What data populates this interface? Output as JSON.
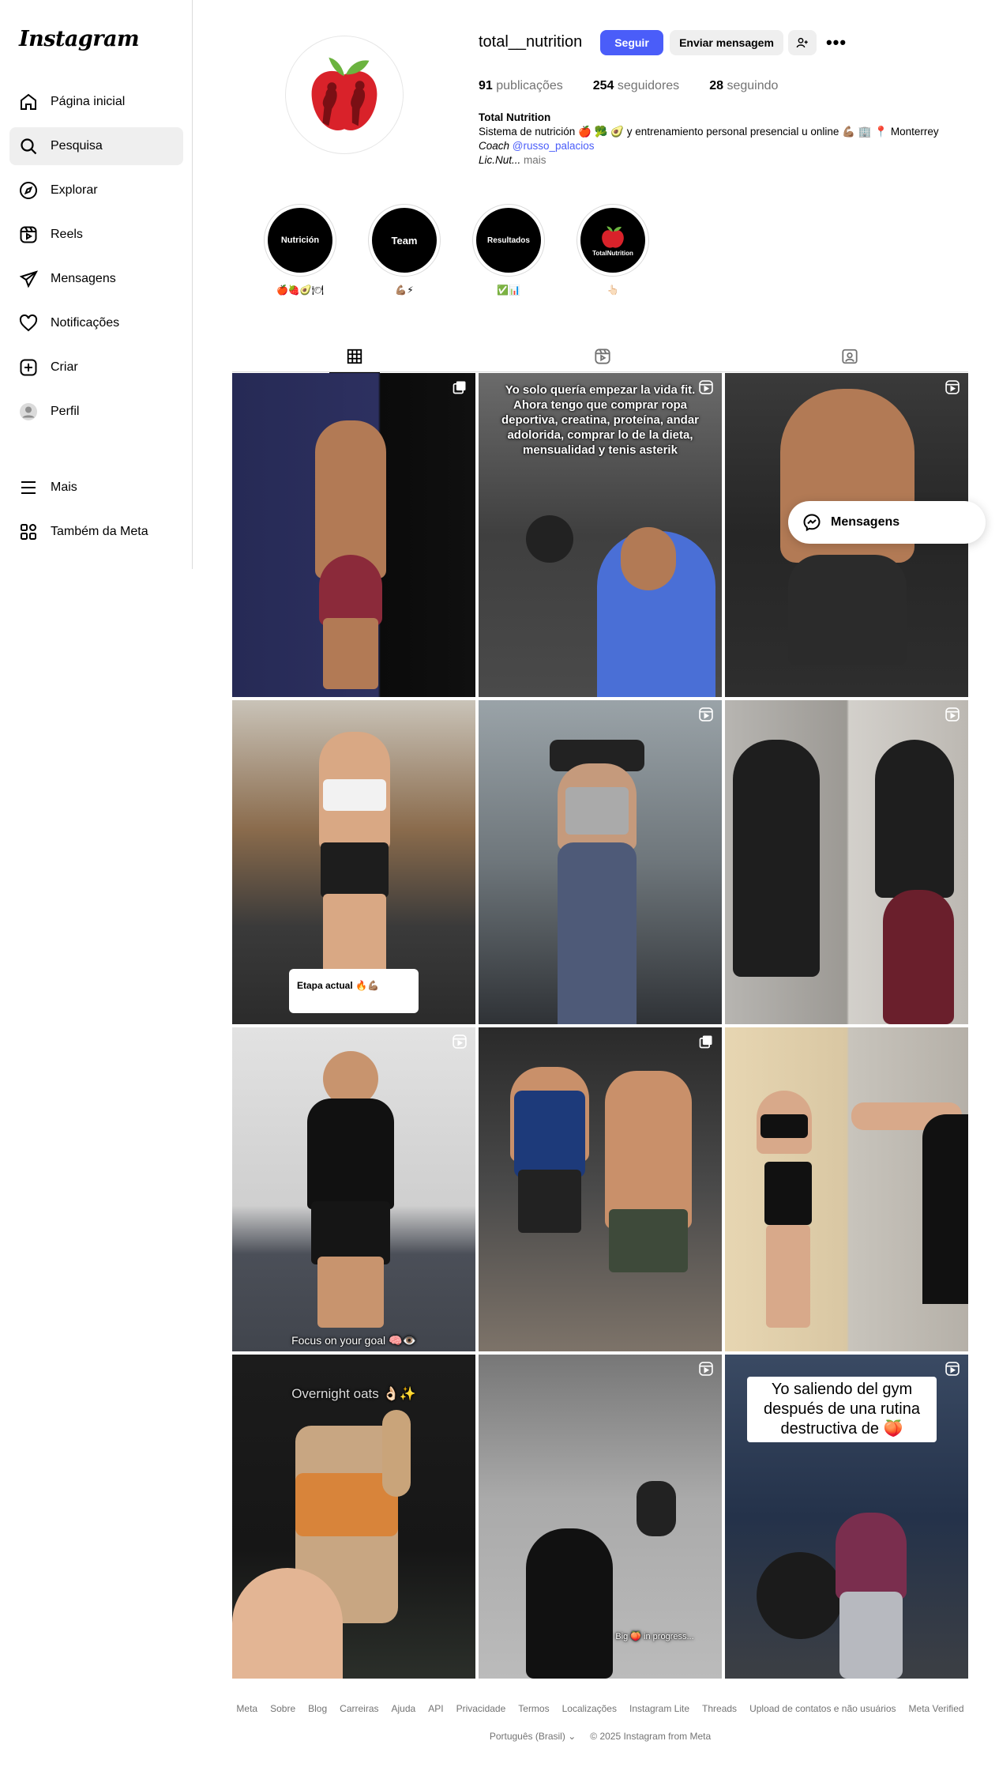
{
  "app": {
    "logo": "Instagram"
  },
  "sidebar": {
    "items": [
      {
        "label": "Página inicial",
        "icon": "home-icon"
      },
      {
        "label": "Pesquisa",
        "icon": "search-icon",
        "active": true
      },
      {
        "label": "Explorar",
        "icon": "compass-icon"
      },
      {
        "label": "Reels",
        "icon": "reels-icon"
      },
      {
        "label": "Mensagens",
        "icon": "send-icon"
      },
      {
        "label": "Notificações",
        "icon": "heart-icon"
      },
      {
        "label": "Criar",
        "icon": "plus-square-icon"
      },
      {
        "label": "Perfil",
        "icon": "avatar-icon"
      },
      {
        "label": "Mais",
        "icon": "menu-icon"
      },
      {
        "label": "Também da Meta",
        "icon": "meta-apps-icon"
      }
    ]
  },
  "profile": {
    "username": "total__nutrition",
    "follow_label": "Seguir",
    "message_label": "Enviar mensagem",
    "stats": {
      "posts_value": "91",
      "posts_label": "publicações",
      "followers_value": "254",
      "followers_label": "seguidores",
      "following_value": "28",
      "following_label": "seguindo"
    },
    "bio": {
      "name": "Total Nutrition",
      "line1": "Sistema de nutrición 🍎 🥦 🥑 y entrenamiento personal presencial u online 💪🏽 🏢 📍 Monterrey",
      "coach_prefix": "Coach",
      "coach_link": "@russo_palacios",
      "line3": "Lic.Nut...",
      "more": "mais"
    },
    "brand_color": "#4a5df9"
  },
  "highlights": [
    {
      "cover_text": "Nutrición",
      "label": "🍎🍓🥑🍽"
    },
    {
      "cover_text": "Team",
      "label": "💪🏽⚡"
    },
    {
      "cover_text": "Resultados",
      "label": "✅📊"
    },
    {
      "cover_text": "TotalNutrition",
      "label": "👆🏻"
    }
  ],
  "posts": [
    {
      "caption": ""
    },
    {
      "caption": "Yo solo quería empezar la vida fit. Ahora tengo que comprar ropa deportiva, creatina, proteína, andar adolorida, comprar lo de la dieta, mensualidad y tenis asterik"
    },
    {
      "caption": ""
    },
    {
      "caption": "Etapa actual 🔥💪🏽"
    },
    {
      "caption": ""
    },
    {
      "caption": ""
    },
    {
      "caption": "Focus on your goal 🧠👁️"
    },
    {
      "caption": ""
    },
    {
      "caption": ""
    },
    {
      "caption": "Overnight oats 👌🏻✨"
    },
    {
      "caption": "Big 🍑 in progress..."
    },
    {
      "caption": "Yo saliendo del gym después de una rutina destructiva de 🍑"
    }
  ],
  "messages_pill": {
    "label": "Mensagens"
  },
  "footer": {
    "links": [
      "Meta",
      "Sobre",
      "Blog",
      "Carreiras",
      "Ajuda",
      "API",
      "Privacidade",
      "Termos",
      "Localizações",
      "Instagram Lite",
      "Threads",
      "Upload de contatos e não usuários",
      "Meta Verified"
    ],
    "language": "Português (Brasil)",
    "copyright": "© 2025 Instagram from Meta"
  }
}
